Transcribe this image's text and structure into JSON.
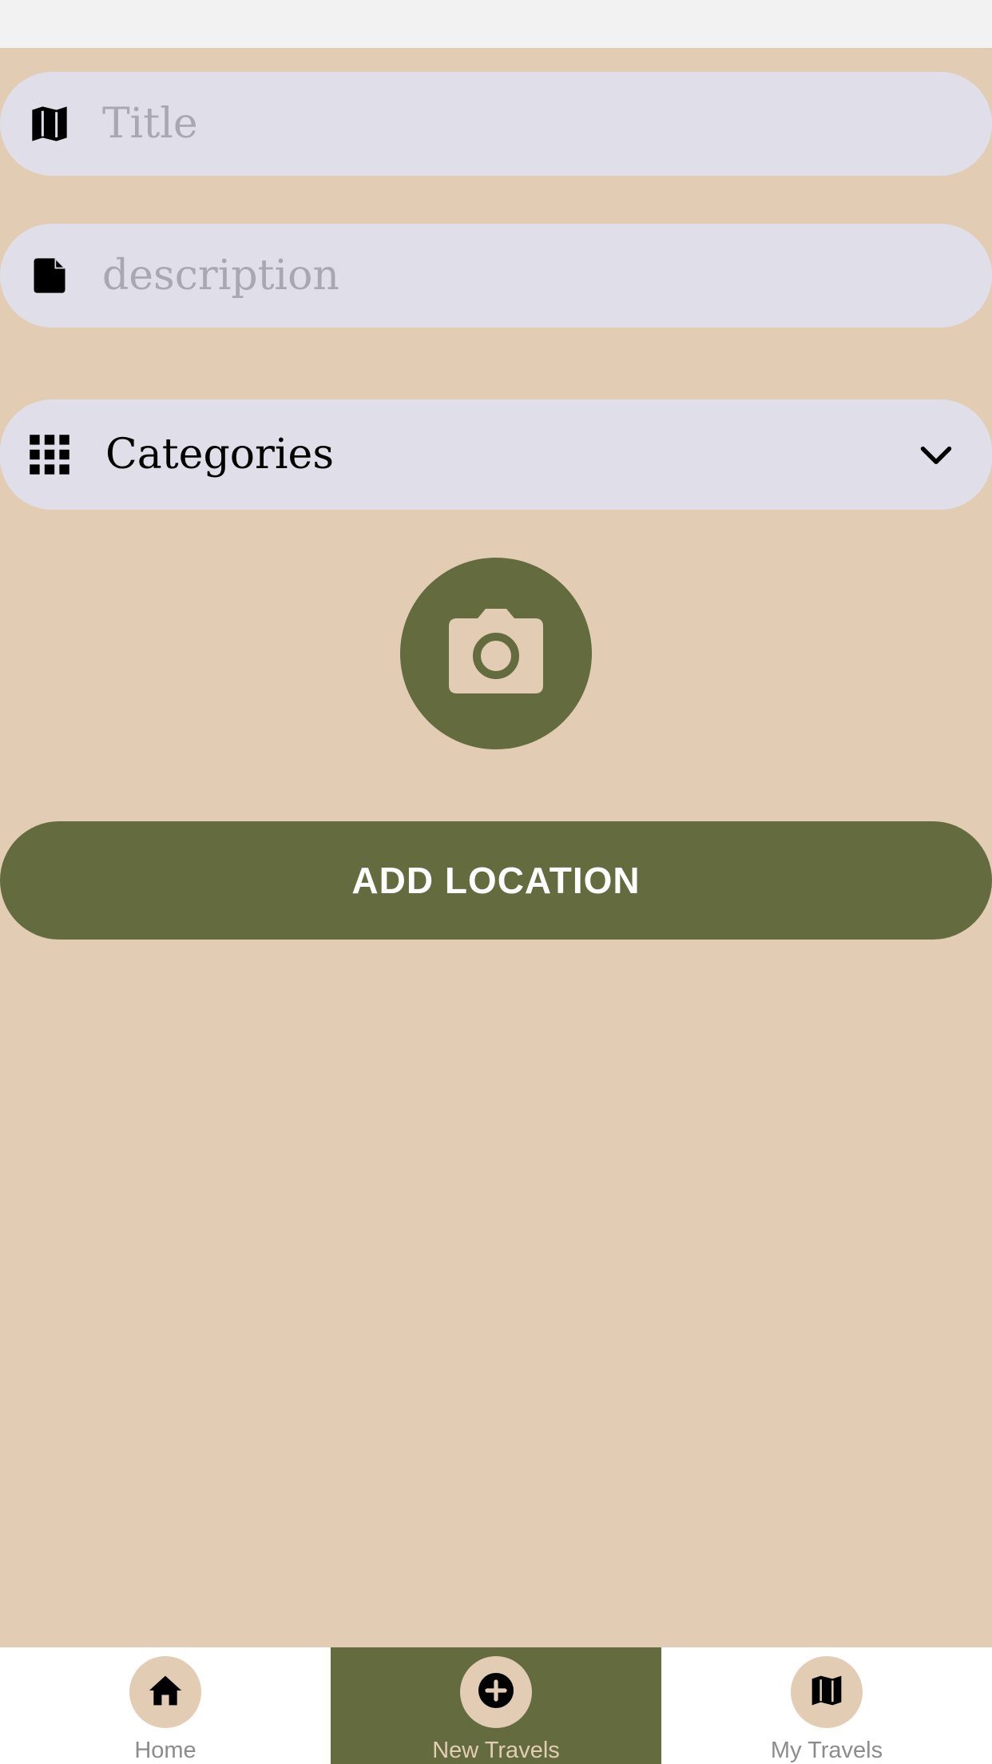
{
  "form": {
    "title_placeholder": "Title",
    "title_value": "",
    "title_icon": "map-icon",
    "description_placeholder": "description",
    "description_value": "",
    "description_icon": "file-icon",
    "categories_label": "Categories",
    "categories_icon": "grid-icon",
    "camera_icon": "camera-icon",
    "add_location_label": "ADD LOCATION"
  },
  "tabbar": {
    "tabs": [
      {
        "label": "Home",
        "icon": "home-icon",
        "active": false
      },
      {
        "label": "New Travels",
        "icon": "plus-circle-icon",
        "active": true
      },
      {
        "label": "My Travels",
        "icon": "map-icon",
        "active": false
      }
    ]
  },
  "colors": {
    "background": "#e2cdb4",
    "accent": "#636b3f",
    "field": "#e0dfe9",
    "placeholder": "#a9a8b1"
  }
}
